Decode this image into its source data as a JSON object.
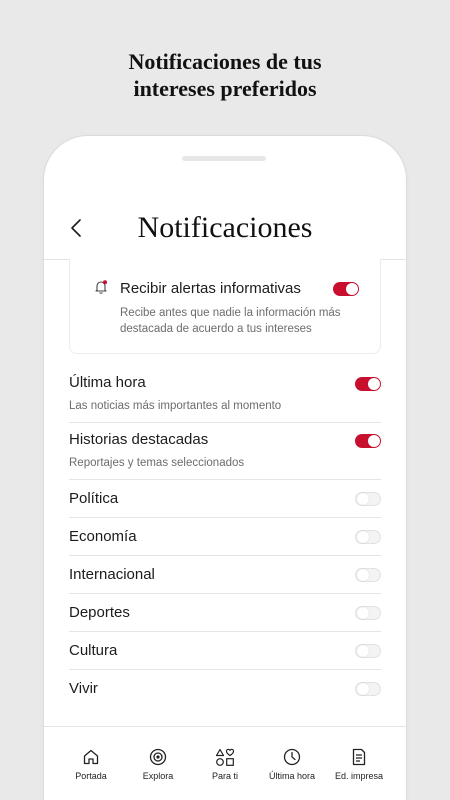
{
  "headline": {
    "line1": "Notificaciones de tus",
    "line2": "intereses preferidos"
  },
  "appbar": {
    "back_icon": "chevron-left-icon",
    "title": "Notificaciones"
  },
  "alert_card": {
    "icon": "bell-icon",
    "title": "Recibir alertas informativas",
    "description": "Recibe antes que nadie la información más destacada de acuerdo a tus intereses",
    "enabled": true
  },
  "settings": [
    {
      "label": "Última hora",
      "description": "Las noticias más importantes al momento",
      "enabled": true
    },
    {
      "label": "Historias destacadas",
      "description": "Reportajes y temas seleccionados",
      "enabled": true
    },
    {
      "label": "Política",
      "enabled": false
    },
    {
      "label": "Economía",
      "enabled": false
    },
    {
      "label": "Internacional",
      "enabled": false
    },
    {
      "label": "Deportes",
      "enabled": false
    },
    {
      "label": "Cultura",
      "enabled": false
    },
    {
      "label": "Vivir",
      "enabled": false
    }
  ],
  "tabbar": [
    {
      "label": "Portada",
      "icon": "home-icon"
    },
    {
      "label": "Explora",
      "icon": "target-icon"
    },
    {
      "label": "Para ti",
      "icon": "shapes-icon"
    },
    {
      "label": "Última hora",
      "icon": "clock-icon"
    },
    {
      "label": "Ed. impresa",
      "icon": "document-icon"
    }
  ],
  "colors": {
    "accent": "#c8102e",
    "background": "#e9e9e9",
    "phone_surface": "#ffffff"
  }
}
